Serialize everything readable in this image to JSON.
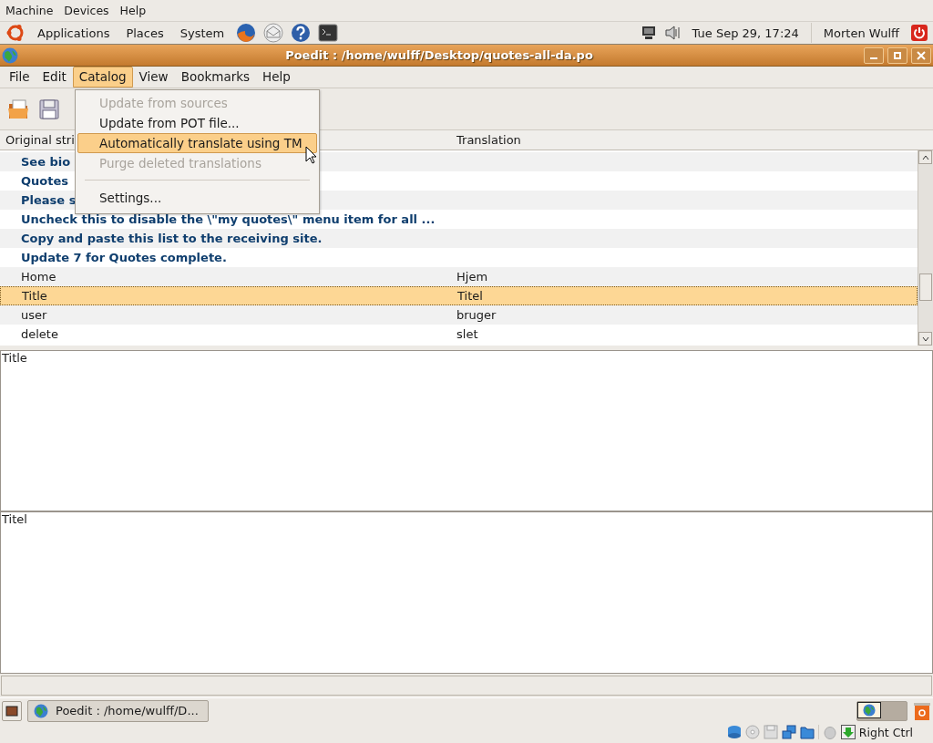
{
  "host_menu": [
    "Machine",
    "Devices",
    "Help"
  ],
  "top_panel": {
    "menus": [
      "Applications",
      "Places",
      "System"
    ],
    "clock": "Tue Sep 29, 17:24",
    "user": "Morten Wulff"
  },
  "window": {
    "title": "Poedit : /home/wulff/Desktop/quotes-all-da.po"
  },
  "menu_bar": [
    {
      "label": "File",
      "selected": false
    },
    {
      "label": "Edit",
      "selected": false
    },
    {
      "label": "Catalog",
      "selected": true
    },
    {
      "label": "View",
      "selected": false
    },
    {
      "label": "Bookmarks",
      "selected": false
    },
    {
      "label": "Help",
      "selected": false
    }
  ],
  "catalog_menu": [
    {
      "kind": "item",
      "label": "Update from sources",
      "disabled": true,
      "selected": false
    },
    {
      "kind": "item",
      "label": "Update from POT file...",
      "disabled": false,
      "selected": false
    },
    {
      "kind": "item",
      "label": "Automatically translate using TM",
      "disabled": false,
      "selected": true
    },
    {
      "kind": "item",
      "label": "Purge deleted translations",
      "disabled": true,
      "selected": false
    },
    {
      "kind": "separator"
    },
    {
      "kind": "item",
      "label": "Settings...",
      "disabled": false,
      "selected": false
    }
  ],
  "table": {
    "columns": [
      "Original stri",
      "Translation"
    ],
    "rows": [
      {
        "original": "See bio",
        "untranslated": true,
        "selected": false
      },
      {
        "original": "Quotes",
        "untranslated": true,
        "selected": false
      },
      {
        "original": "Please s",
        "untranslated": true,
        "selected": false
      },
      {
        "original": "Uncheck this to disable the \\\"my quotes\\\" menu item for all ...",
        "untranslated": true,
        "selected": false
      },
      {
        "original": "Copy and paste this list to the receiving site.",
        "untranslated": true,
        "selected": false
      },
      {
        "original": "Update 7 for Quotes complete.",
        "untranslated": true,
        "selected": false
      },
      {
        "original": "Home",
        "translation": "Hjem",
        "untranslated": false,
        "selected": false
      },
      {
        "original": "Title",
        "translation": "Titel",
        "untranslated": false,
        "selected": true
      },
      {
        "original": "user",
        "translation": "bruger",
        "untranslated": false,
        "selected": false
      },
      {
        "original": "delete",
        "translation": "slet",
        "untranslated": false,
        "selected": false
      }
    ]
  },
  "original_text": "Title",
  "translation_text": "Titel",
  "taskbar": {
    "task": "Poedit : /home/wulff/D..."
  },
  "vbox_status": {
    "host_key": "Right Ctrl"
  }
}
